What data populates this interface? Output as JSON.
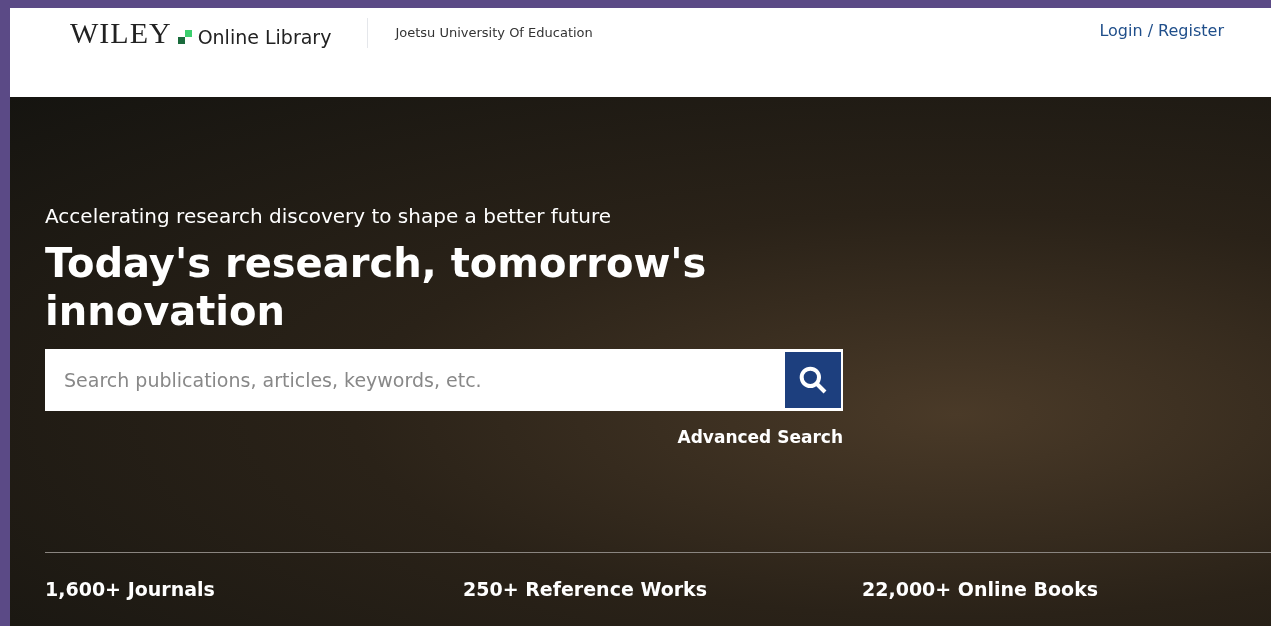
{
  "header": {
    "logo": {
      "wordmark": "WILEY",
      "product": "Online Library"
    },
    "institution": "Joetsu University Of Education",
    "login": "Login / Register"
  },
  "hero": {
    "tagline": "Accelerating research discovery to shape a better future",
    "headline": "Today's research, tomorrow's innovation",
    "search": {
      "placeholder": "Search publications, articles, keywords, etc."
    },
    "advanced_search": "Advanced Search"
  },
  "stats": [
    "1,600+ Journals",
    "250+ Reference Works",
    "22,000+ Online Books"
  ]
}
